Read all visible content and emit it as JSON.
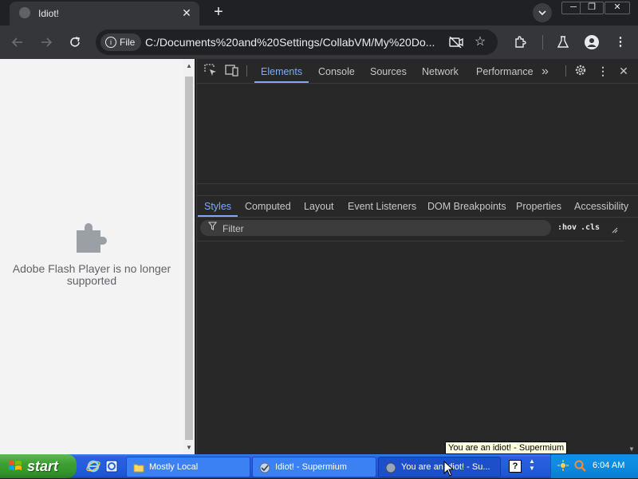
{
  "browser": {
    "tab_title": "Idiot!",
    "tab_close": "✕",
    "new_tab": "+",
    "window_controls": [
      "─",
      "❐",
      "✕"
    ],
    "site_chip": "File",
    "url": "C:/Documents%20and%20Settings/CollabVM/My%20Do...",
    "icons": [
      "back-arrow-icon",
      "forward-arrow-icon",
      "reload-icon",
      "camera-blocked-icon",
      "star-icon",
      "extensions-icon",
      "labs-flask-icon",
      "profile-icon",
      "more-vert-icon"
    ]
  },
  "page": {
    "message": "Adobe Flash Player is no longer supported",
    "icon": "plugin-puzzle-icon"
  },
  "devtools": {
    "tabs": [
      "Elements",
      "Console",
      "Sources",
      "Network",
      "Performance"
    ],
    "active_tab": "Elements",
    "more": "»",
    "sub_tabs": [
      "Styles",
      "Computed",
      "Layout",
      "Event Listeners",
      "DOM Breakpoints",
      "Properties",
      "Accessibility"
    ],
    "active_sub_tab": "Styles",
    "filter_placeholder": "Filter",
    "hov": ":hov",
    "cls": ".cls"
  },
  "tooltip": "You are an idiot! - Supermium",
  "taskbar": {
    "start": "start",
    "tasks": [
      {
        "label": "Mostly Local",
        "icon": "folder-icon"
      },
      {
        "label": "Idiot! - Supermium",
        "icon": "supermium-icon"
      },
      {
        "label": "You are an idiot! - Su...",
        "icon": "supermium-icon"
      }
    ],
    "clock": "6:04 AM"
  },
  "colors": {
    "accent": "#7cacf8",
    "xp_blue": "#245edc",
    "xp_green": "#3c9f33",
    "tray": "#0d8ce0"
  }
}
